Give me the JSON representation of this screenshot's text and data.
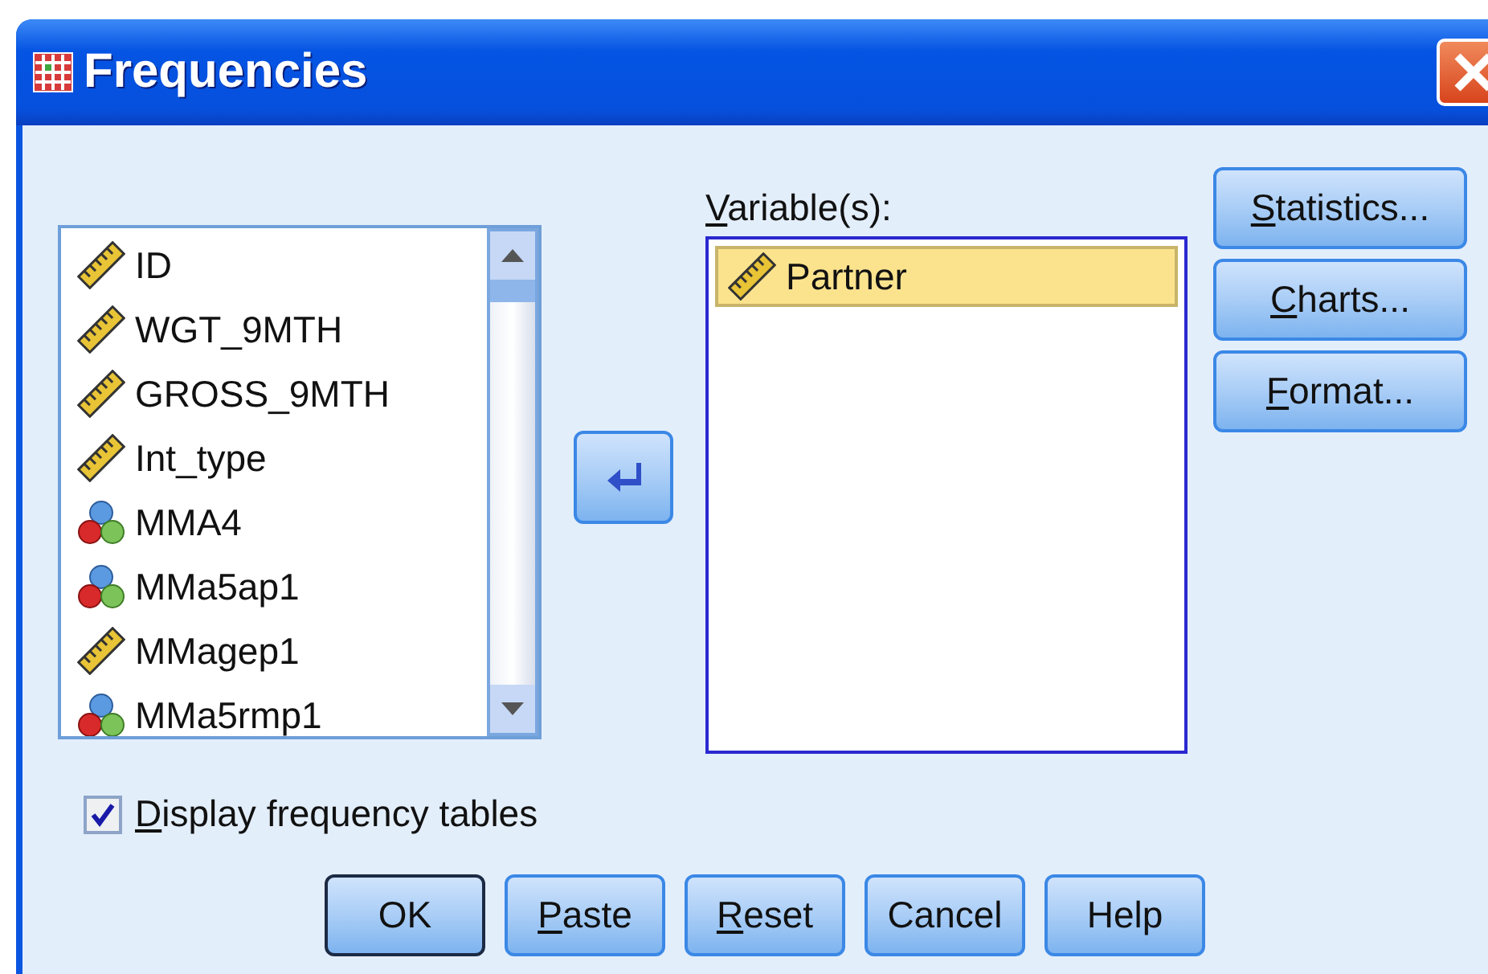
{
  "window": {
    "title": "Frequencies"
  },
  "source_list": {
    "items": [
      {
        "name": "ID",
        "kind": "scale",
        "selected": false
      },
      {
        "name": "WGT_9MTH",
        "kind": "scale",
        "selected": false
      },
      {
        "name": "GROSS_9MTH",
        "kind": "scale",
        "selected": false
      },
      {
        "name": "Int_type",
        "kind": "scale",
        "selected": false
      },
      {
        "name": "MMA4",
        "kind": "nominal",
        "selected": false
      },
      {
        "name": "MMa5ap1",
        "kind": "nominal",
        "selected": false
      },
      {
        "name": "MMagep1",
        "kind": "scale",
        "selected": false
      },
      {
        "name": "MMa5rmp1",
        "kind": "nominal",
        "selected": false
      }
    ]
  },
  "variables": {
    "label": "Variable(s):",
    "mnemonic": true,
    "items": [
      {
        "name": "Partner",
        "kind": "scale",
        "selected": true
      }
    ]
  },
  "side_buttons": [
    {
      "label": "Statistics...",
      "mnemonic": true
    },
    {
      "label": "Charts...",
      "mnemonic": true
    },
    {
      "label": "Format...",
      "mnemonic": true
    }
  ],
  "display_tables": {
    "label": "Display frequency tables",
    "mnemonic": true,
    "checked": true
  },
  "buttons": [
    {
      "label": "OK",
      "mnemonic": false,
      "default": true
    },
    {
      "label": "Paste",
      "mnemonic": true,
      "default": false
    },
    {
      "label": "Reset",
      "mnemonic": true,
      "default": false
    },
    {
      "label": "Cancel",
      "mnemonic": false,
      "default": false
    },
    {
      "label": "Help",
      "mnemonic": false,
      "default": false
    }
  ]
}
